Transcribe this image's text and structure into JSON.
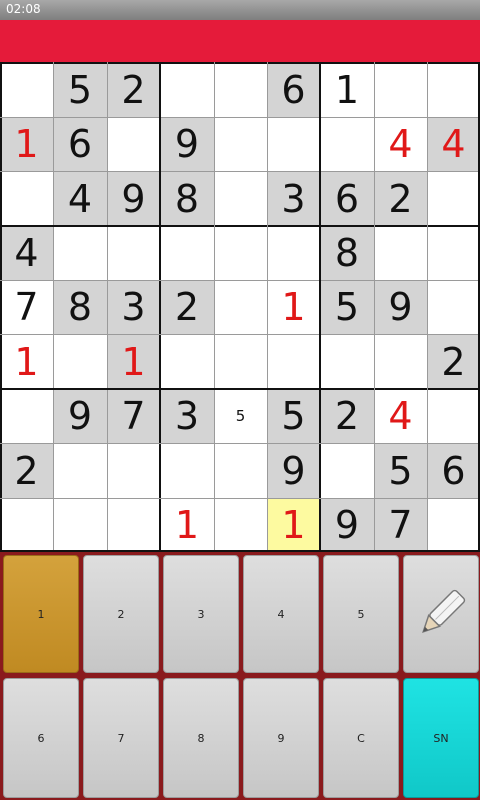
{
  "status_bar": {
    "time": "02:08"
  },
  "board": {
    "rows": [
      [
        {
          "v": "",
          "g": 0,
          "r": 0
        },
        {
          "v": "5",
          "g": 1,
          "r": 0
        },
        {
          "v": "2",
          "g": 1,
          "r": 0
        },
        {
          "v": "",
          "g": 0,
          "r": 0
        },
        {
          "v": "",
          "g": 0,
          "r": 0
        },
        {
          "v": "6",
          "g": 1,
          "r": 0
        },
        {
          "v": "1",
          "g": 0,
          "r": 0
        },
        {
          "v": "",
          "g": 0,
          "r": 0
        },
        {
          "v": "",
          "g": 0,
          "r": 0
        }
      ],
      [
        {
          "v": "1",
          "g": 1,
          "r": 1
        },
        {
          "v": "6",
          "g": 1,
          "r": 0
        },
        {
          "v": "",
          "g": 0,
          "r": 0
        },
        {
          "v": "9",
          "g": 1,
          "r": 0
        },
        {
          "v": "",
          "g": 0,
          "r": 0
        },
        {
          "v": "",
          "g": 0,
          "r": 0
        },
        {
          "v": "",
          "g": 0,
          "r": 0
        },
        {
          "v": "4",
          "g": 0,
          "r": 1
        },
        {
          "v": "4",
          "g": 1,
          "r": 1
        }
      ],
      [
        {
          "v": "",
          "g": 0,
          "r": 0
        },
        {
          "v": "4",
          "g": 1,
          "r": 0
        },
        {
          "v": "9",
          "g": 1,
          "r": 0
        },
        {
          "v": "8",
          "g": 1,
          "r": 0
        },
        {
          "v": "",
          "g": 0,
          "r": 0
        },
        {
          "v": "3",
          "g": 1,
          "r": 0
        },
        {
          "v": "6",
          "g": 1,
          "r": 0
        },
        {
          "v": "2",
          "g": 1,
          "r": 0
        },
        {
          "v": "",
          "g": 0,
          "r": 0
        }
      ],
      [
        {
          "v": "4",
          "g": 1,
          "r": 0
        },
        {
          "v": "",
          "g": 0,
          "r": 0
        },
        {
          "v": "",
          "g": 0,
          "r": 0
        },
        {
          "v": "",
          "g": 0,
          "r": 0
        },
        {
          "v": "",
          "g": 0,
          "r": 0
        },
        {
          "v": "",
          "g": 0,
          "r": 0
        },
        {
          "v": "8",
          "g": 1,
          "r": 0
        },
        {
          "v": "",
          "g": 0,
          "r": 0
        },
        {
          "v": "",
          "g": 0,
          "r": 0
        }
      ],
      [
        {
          "v": "7",
          "g": 0,
          "r": 0
        },
        {
          "v": "8",
          "g": 1,
          "r": 0
        },
        {
          "v": "3",
          "g": 1,
          "r": 0
        },
        {
          "v": "2",
          "g": 1,
          "r": 0
        },
        {
          "v": "",
          "g": 0,
          "r": 0
        },
        {
          "v": "1",
          "g": 0,
          "r": 1
        },
        {
          "v": "5",
          "g": 1,
          "r": 0
        },
        {
          "v": "9",
          "g": 1,
          "r": 0
        },
        {
          "v": "",
          "g": 0,
          "r": 0
        }
      ],
      [
        {
          "v": "1",
          "g": 0,
          "r": 1
        },
        {
          "v": "",
          "g": 0,
          "r": 0
        },
        {
          "v": "1",
          "g": 1,
          "r": 1
        },
        {
          "v": "",
          "g": 0,
          "r": 0
        },
        {
          "v": "",
          "g": 0,
          "r": 0
        },
        {
          "v": "",
          "g": 0,
          "r": 0
        },
        {
          "v": "",
          "g": 0,
          "r": 0
        },
        {
          "v": "",
          "g": 0,
          "r": 0
        },
        {
          "v": "2",
          "g": 1,
          "r": 0
        }
      ],
      [
        {
          "v": "",
          "g": 0,
          "r": 0
        },
        {
          "v": "9",
          "g": 1,
          "r": 0
        },
        {
          "v": "7",
          "g": 1,
          "r": 0
        },
        {
          "v": "3",
          "g": 1,
          "r": 0
        },
        {
          "v": "5",
          "g": 0,
          "r": 0,
          "note": 1
        },
        {
          "v": "5",
          "g": 1,
          "r": 0
        },
        {
          "v": "2",
          "g": 1,
          "r": 0
        },
        {
          "v": "4",
          "g": 0,
          "r": 1
        },
        {
          "v": "",
          "g": 0,
          "r": 0
        }
      ],
      [
        {
          "v": "2",
          "g": 1,
          "r": 0
        },
        {
          "v": "",
          "g": 0,
          "r": 0
        },
        {
          "v": "",
          "g": 0,
          "r": 0
        },
        {
          "v": "",
          "g": 0,
          "r": 0
        },
        {
          "v": "",
          "g": 0,
          "r": 0
        },
        {
          "v": "9",
          "g": 1,
          "r": 0
        },
        {
          "v": "",
          "g": 0,
          "r": 0
        },
        {
          "v": "5",
          "g": 1,
          "r": 0
        },
        {
          "v": "6",
          "g": 1,
          "r": 0
        }
      ],
      [
        {
          "v": "",
          "g": 0,
          "r": 0
        },
        {
          "v": "",
          "g": 0,
          "r": 0
        },
        {
          "v": "",
          "g": 0,
          "r": 0
        },
        {
          "v": "1",
          "g": 0,
          "r": 1
        },
        {
          "v": "",
          "g": 0,
          "r": 0
        },
        {
          "v": "1",
          "g": 0,
          "r": 1,
          "hl": 1
        },
        {
          "v": "9",
          "g": 1,
          "r": 0
        },
        {
          "v": "7",
          "g": 1,
          "r": 0
        },
        {
          "v": "",
          "g": 0,
          "r": 0
        }
      ]
    ]
  },
  "keypad": {
    "rows": [
      [
        {
          "label": "1",
          "name": "digit-1-button",
          "active": 1
        },
        {
          "label": "2",
          "name": "digit-2-button"
        },
        {
          "label": "3",
          "name": "digit-3-button"
        },
        {
          "label": "4",
          "name": "digit-4-button"
        },
        {
          "label": "5",
          "name": "digit-5-button"
        },
        {
          "label": "",
          "name": "pencil-mode-button",
          "icon": "pencil-icon"
        }
      ],
      [
        {
          "label": "6",
          "name": "digit-6-button"
        },
        {
          "label": "7",
          "name": "digit-7-button"
        },
        {
          "label": "8",
          "name": "digit-8-button"
        },
        {
          "label": "9",
          "name": "digit-9-button"
        },
        {
          "label": "C",
          "name": "clear-button"
        },
        {
          "label": "SN",
          "name": "sn-button",
          "teal": 1
        }
      ]
    ]
  },
  "colors": {
    "title_bar": "#e51b3a",
    "given_cell": "#d4d4d4",
    "highlight_cell": "#fdfaa0",
    "error_digit": "#e01818",
    "active_key": "#c99a2e",
    "teal_key": "#14d4d4"
  }
}
